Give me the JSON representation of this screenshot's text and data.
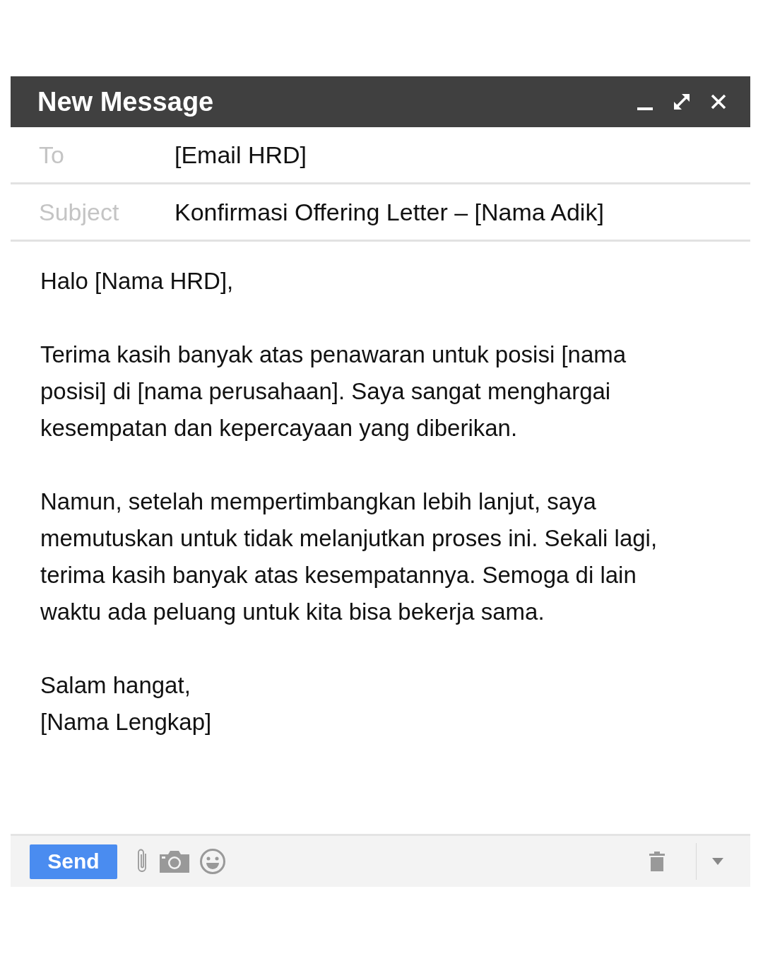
{
  "window": {
    "title": "New Message"
  },
  "fields": [
    {
      "label": "To",
      "value": "[Email HRD]"
    },
    {
      "label": "Subject",
      "value": "Konfirmasi Offering Letter – [Nama Adik]"
    }
  ],
  "body": [
    "Halo [Nama HRD],",
    "Terima kasih banyak atas penawaran untuk posisi [nama posisi] di [nama perusahaan]. Saya sangat menghargai kesempatan dan kepercayaan yang diberikan.",
    "Namun, setelah mempertimbangkan lebih lanjut, saya memutuskan untuk tidak melanjutkan proses ini. Sekali lagi, terima kasih banyak atas kesempatannya. Semoga di lain waktu ada peluang untuk kita bisa bekerja sama.",
    "Salam hangat,\n[Nama Lengkap]"
  ],
  "toolbar": {
    "send": "Send"
  }
}
